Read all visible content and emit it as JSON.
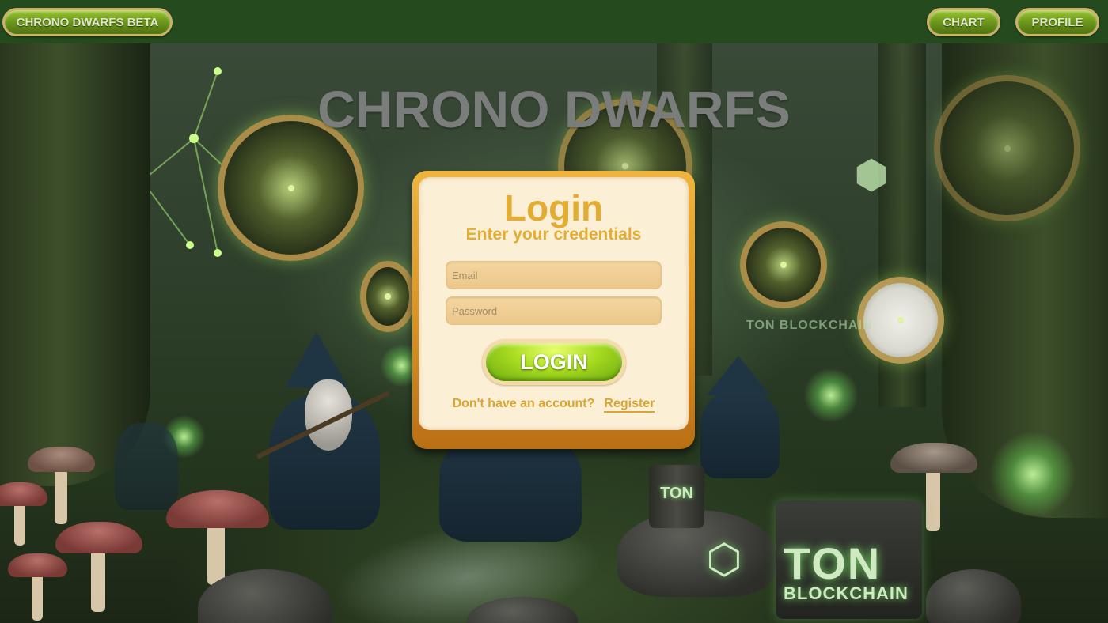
{
  "header": {
    "brand_label": "CHRONO DWARFS BETA",
    "nav": [
      {
        "label": "CHART"
      },
      {
        "label": "PROFILE"
      }
    ]
  },
  "hero": {
    "title": "CHRONO DWARFS"
  },
  "login_card": {
    "title": "Login",
    "subtitle": "Enter your credentials",
    "email_placeholder": "Email",
    "email_value": "",
    "password_placeholder": "Password",
    "password_value": "",
    "login_button_label": "LOGIN",
    "no_account_text": "Don't have an account?",
    "register_link_label": "Register"
  },
  "background": {
    "ton_big_label": "TON",
    "ton_big_sub_label": "BLOCKCHAIN",
    "ton_small_label": "TON",
    "ton_sign_label": "TON BLOCKCHAIN",
    "icons": [
      "ton-hexagon-icon",
      "ton-cube-icon"
    ]
  },
  "colors": {
    "topbar_bg": "#254a1d",
    "card_bg": "#fbefd6",
    "card_frame": "#e0a02f",
    "accent_text": "#e3ad33",
    "login_button": "#a8dc20"
  }
}
